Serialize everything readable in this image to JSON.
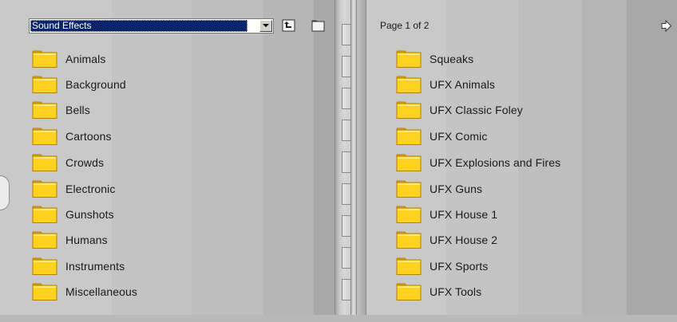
{
  "dropdown": {
    "selected": "Sound Effects"
  },
  "toolbar": {
    "up_folder_icon": "up-one-level-icon",
    "new_folder_icon": "new-folder-icon"
  },
  "left_list": {
    "items": [
      {
        "label": "Animals"
      },
      {
        "label": "Background"
      },
      {
        "label": "Bells"
      },
      {
        "label": "Cartoons"
      },
      {
        "label": "Crowds"
      },
      {
        "label": "Electronic"
      },
      {
        "label": "Gunshots"
      },
      {
        "label": "Humans"
      },
      {
        "label": "Instruments"
      },
      {
        "label": "Miscellaneous"
      }
    ]
  },
  "pager": {
    "text": "Page 1 of 2",
    "next_icon": "next-page-arrow-icon"
  },
  "right_list": {
    "items": [
      {
        "label": "Squeaks"
      },
      {
        "label": "UFX Animals"
      },
      {
        "label": "UFX Classic Foley"
      },
      {
        "label": "UFX Comic"
      },
      {
        "label": "UFX Explosions and Fires"
      },
      {
        "label": "UFX Guns"
      },
      {
        "label": "UFX House 1"
      },
      {
        "label": "UFX House 2"
      },
      {
        "label": "UFX Sports"
      },
      {
        "label": "UFX Tools"
      }
    ]
  },
  "colors": {
    "folder": "#ffd21f",
    "selection": "#0a246a",
    "pane": "#c9c9c9"
  }
}
